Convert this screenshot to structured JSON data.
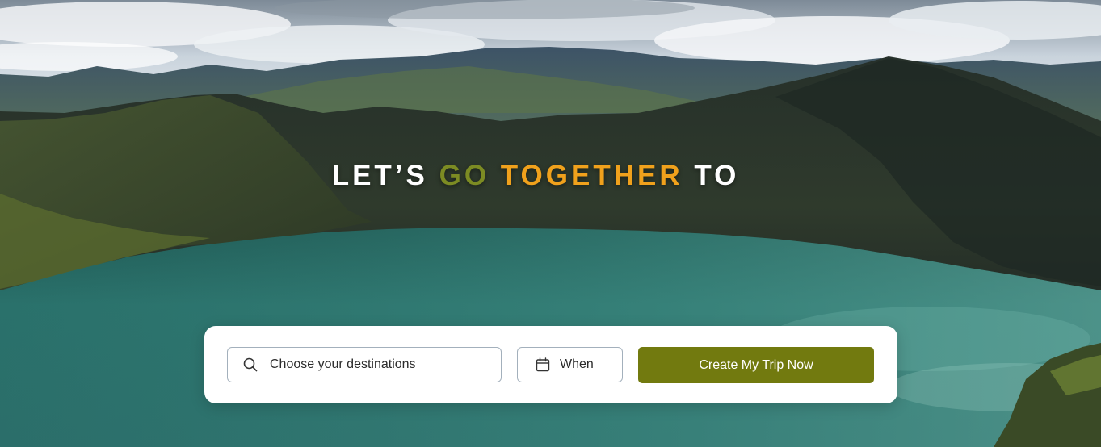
{
  "hero": {
    "headline": {
      "part1": "LET’S ",
      "part2": "GO",
      "part3": " ",
      "part4": "TOGETHER",
      "part5": " TO"
    },
    "colors": {
      "go": "#7c8b23",
      "together": "#f0a11c",
      "text": "#ffffff"
    }
  },
  "search": {
    "destination": {
      "placeholder": "Choose your destinations",
      "icon": "search-icon"
    },
    "when": {
      "label": "When",
      "icon": "calendar-icon"
    },
    "submit": {
      "label": "Create My Trip Now",
      "color": "#727a0f"
    }
  }
}
